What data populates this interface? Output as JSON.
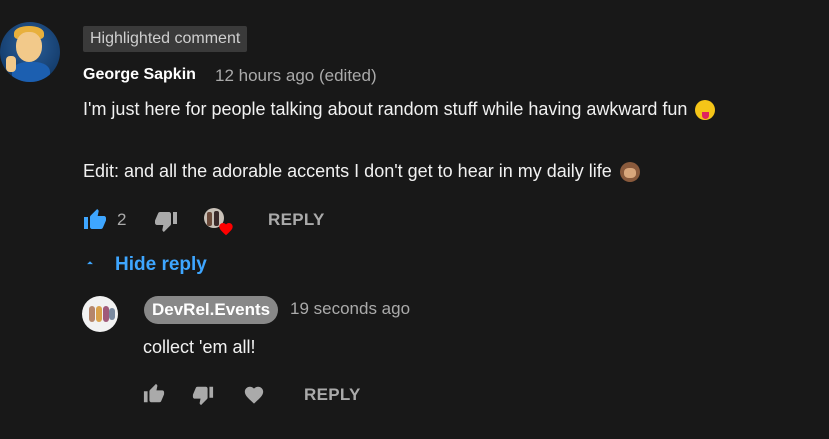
{
  "comment": {
    "badge": "Highlighted comment",
    "author": "George Sapkin",
    "time": "12 hours ago (edited)",
    "line1": "I'm just here for people talking about random stuff while having awkward fun",
    "line2": "Edit: and all the adorable accents I don't get to hear in my daily life",
    "like_count": "2",
    "reply_label": "REPLY",
    "hide_reply_label": "Hide reply",
    "emoji1": "zany-face-emoji",
    "emoji2": "see-no-evil-monkey-emoji"
  },
  "reply": {
    "author": "DevRel.Events",
    "time": "19 seconds ago",
    "text": "collect 'em all!",
    "reply_label": "REPLY"
  },
  "colors": {
    "background": "#181818",
    "link_blue": "#3ea6ff",
    "like_active": "#3ea6ff",
    "heart_red": "#ff0000",
    "muted_text": "#aaaaaa"
  }
}
